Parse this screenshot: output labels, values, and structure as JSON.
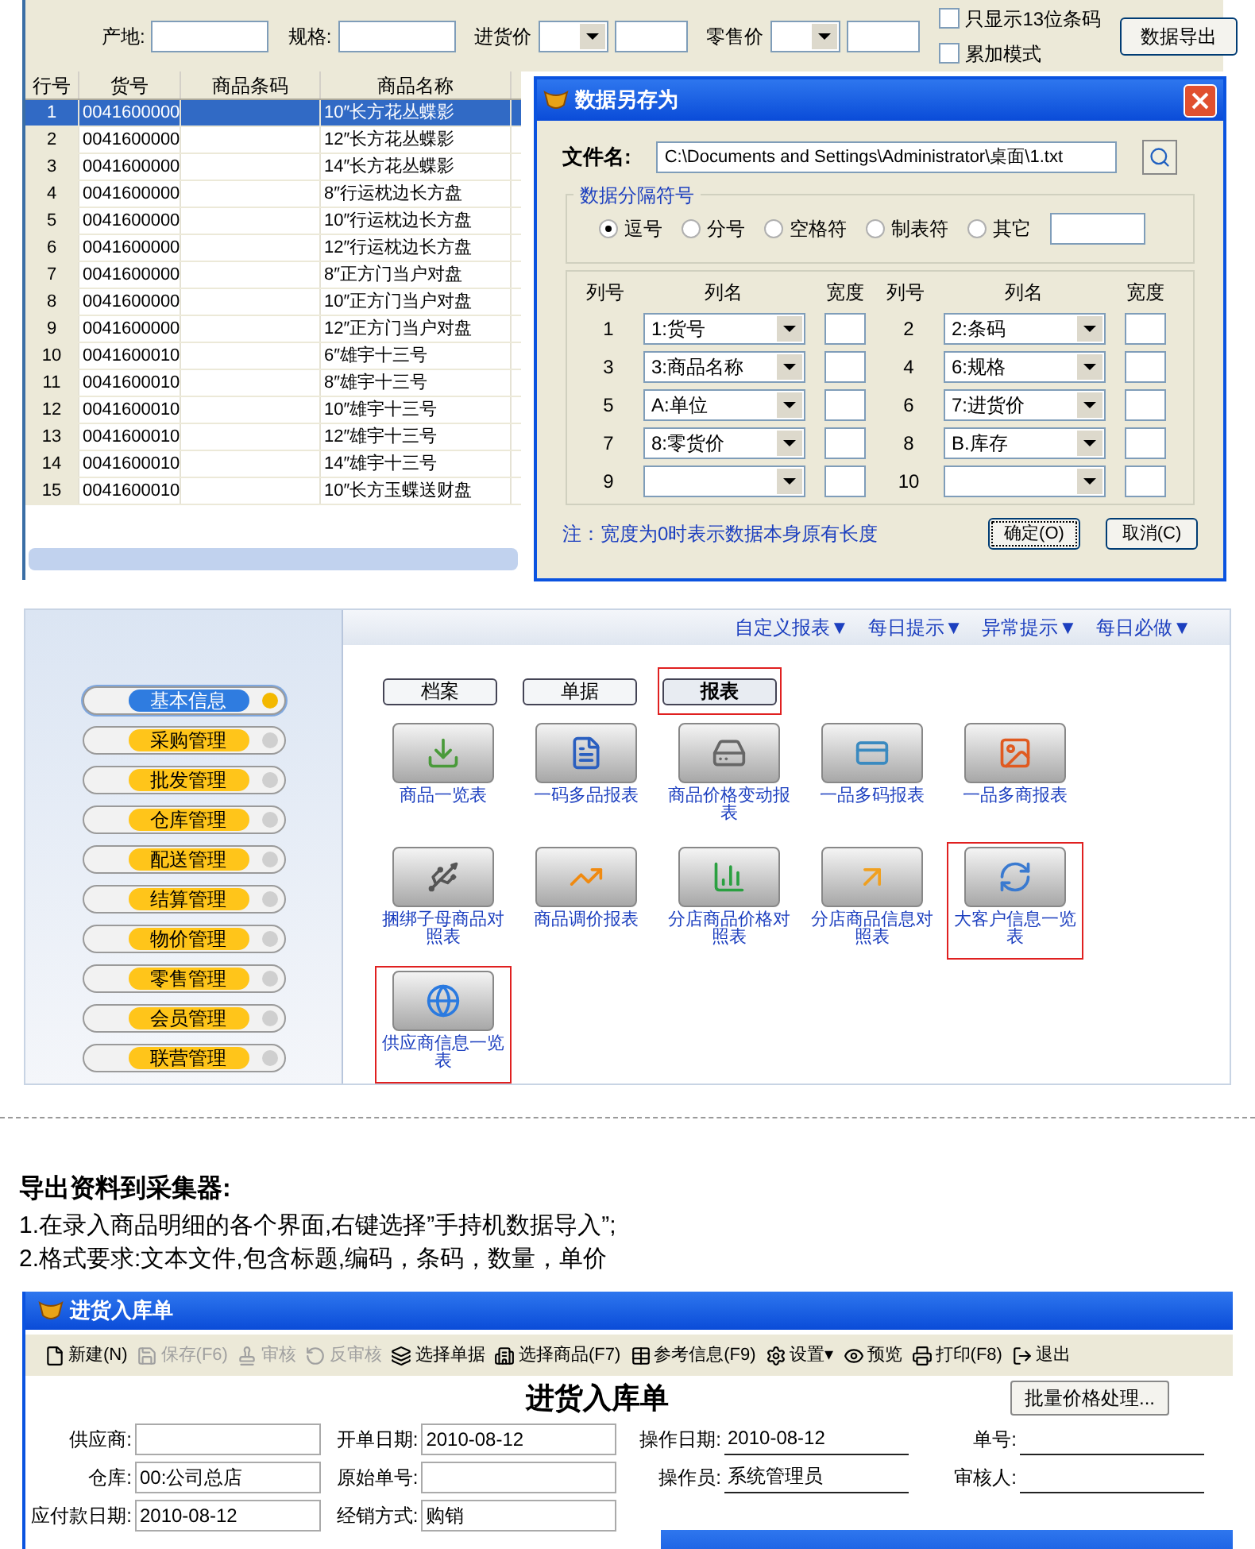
{
  "filter_bar": {
    "fields": [
      {
        "label": "产地:",
        "kind": "text"
      },
      {
        "label": "规格:",
        "kind": "text"
      },
      {
        "label": "进货价",
        "kind": "range"
      },
      {
        "label": "零售价",
        "kind": "range"
      }
    ],
    "checkboxes": [
      {
        "label": "只显示13位条码",
        "checked": false
      },
      {
        "label": "累加模式",
        "checked": false
      }
    ],
    "export_button": "数据导出"
  },
  "grid": {
    "columns": [
      "行号",
      "货号",
      "商品条码",
      "商品名称"
    ],
    "rows": [
      {
        "cells": [
          "1",
          "0041600000",
          "",
          "10″长方花丛蝶影"
        ],
        "selected": true
      },
      {
        "cells": [
          "2",
          "0041600000",
          "",
          "12″长方花丛蝶影"
        ],
        "selected": false
      },
      {
        "cells": [
          "3",
          "0041600000",
          "",
          "14″长方花丛蝶影"
        ],
        "selected": false
      },
      {
        "cells": [
          "4",
          "0041600000",
          "",
          "8″行运枕边长方盘"
        ],
        "selected": false
      },
      {
        "cells": [
          "5",
          "0041600000",
          "",
          "10″行运枕边长方盘"
        ],
        "selected": false
      },
      {
        "cells": [
          "6",
          "0041600000",
          "",
          "12″行运枕边长方盘"
        ],
        "selected": false
      },
      {
        "cells": [
          "7",
          "0041600000",
          "",
          "8″正方门当户对盘"
        ],
        "selected": false
      },
      {
        "cells": [
          "8",
          "0041600000",
          "",
          "10″正方门当户对盘"
        ],
        "selected": false
      },
      {
        "cells": [
          "9",
          "0041600000",
          "",
          "12″正方门当户对盘"
        ],
        "selected": false
      },
      {
        "cells": [
          "10",
          "0041600010",
          "",
          "6″雄宇十三号"
        ],
        "selected": false
      },
      {
        "cells": [
          "11",
          "0041600010",
          "",
          "8″雄宇十三号"
        ],
        "selected": false
      },
      {
        "cells": [
          "12",
          "0041600010",
          "",
          "10″雄宇十三号"
        ],
        "selected": false
      },
      {
        "cells": [
          "13",
          "0041600010",
          "",
          "12″雄宇十三号"
        ],
        "selected": false
      },
      {
        "cells": [
          "14",
          "0041600010",
          "",
          "14″雄宇十三号"
        ],
        "selected": false
      },
      {
        "cells": [
          "15",
          "0041600010",
          "",
          "10″长方玉蝶送财盘"
        ],
        "selected": false
      }
    ]
  },
  "save_dialog": {
    "title": "数据另存为",
    "file_label": "文件名:",
    "file_value": "C:\\Documents and Settings\\Administrator\\桌面\\1.txt",
    "separator_title": "数据分隔符号",
    "separators": [
      {
        "label": "逗号",
        "selected": true
      },
      {
        "label": "分号",
        "selected": false
      },
      {
        "label": "空格符",
        "selected": false
      },
      {
        "label": "制表符",
        "selected": false
      },
      {
        "label": "其它",
        "selected": false
      }
    ],
    "column_headers": [
      [
        "列号",
        "列名",
        "宽度"
      ],
      [
        "列号",
        "列名",
        "宽度"
      ]
    ],
    "columns": [
      {
        "no": "1",
        "name": "1:货号"
      },
      {
        "no": "2",
        "name": "2:条码"
      },
      {
        "no": "3",
        "name": "3:商品名称"
      },
      {
        "no": "4",
        "name": "6:规格"
      },
      {
        "no": "5",
        "name": "A:单位"
      },
      {
        "no": "6",
        "name": "7:进货价"
      },
      {
        "no": "7",
        "name": "8:零货价"
      },
      {
        "no": "8",
        "name": "B.库存"
      },
      {
        "no": "9"
      },
      {
        "no": "10"
      }
    ],
    "note": "注：宽度为0时表示数据本身原有长度",
    "buttons": [
      "确定(O)",
      "取消(C)"
    ]
  },
  "main_app": {
    "top_links": [
      "自定义报表▼",
      "每日提示▼",
      "异常提示▼",
      "每日必做▼"
    ],
    "sidebar": [
      {
        "label": "基本信息",
        "selected": true
      },
      {
        "label": "采购管理",
        "selected": false
      },
      {
        "label": "批发管理",
        "selected": false
      },
      {
        "label": "仓库管理",
        "selected": false
      },
      {
        "label": "配送管理",
        "selected": false
      },
      {
        "label": "结算管理",
        "selected": false
      },
      {
        "label": "物价管理",
        "selected": false
      },
      {
        "label": "零售管理",
        "selected": false
      },
      {
        "label": "会员管理",
        "selected": false
      },
      {
        "label": "联营管理",
        "selected": false
      }
    ],
    "tabs": [
      {
        "label": "档案",
        "selected": false
      },
      {
        "label": "单据",
        "selected": false
      },
      {
        "label": "报表",
        "selected": true
      }
    ],
    "reports": [
      {
        "label": "商品一览表",
        "highlighted": false
      },
      {
        "label": "一码多品报表",
        "highlighted": false
      },
      {
        "label": "商品价格变动报表",
        "highlighted": false
      },
      {
        "label": "一品多码报表",
        "highlighted": false
      },
      {
        "label": "一品多商报表",
        "highlighted": false
      },
      {
        "label": "捆绑子母商品对照表",
        "highlighted": false
      },
      {
        "label": "商品调价报表",
        "highlighted": false
      },
      {
        "label": "分店商品价格对照表",
        "highlighted": false
      },
      {
        "label": "分店商品信息对照表",
        "highlighted": false
      },
      {
        "label": "大客户信息一览表",
        "highlighted": true
      },
      {
        "label": "供应商信息一览表",
        "highlighted": true
      }
    ]
  },
  "article": {
    "heading": "导出资料到采集器:",
    "lines": [
      "1.在录入商品明细的各个界面,右键选择”手持机数据导入”;",
      "2.格式要求:文本文件,包含标题,编码，条码，数量，单价"
    ]
  },
  "receipt_window": {
    "title": "进货入库单",
    "toolbar": [
      {
        "label": "新建(N)",
        "disabled": false
      },
      {
        "label": "保存(F6)",
        "disabled": true
      },
      {
        "label": "审核",
        "disabled": true
      },
      {
        "label": "反审核",
        "disabled": true
      },
      {
        "label": "选择单据",
        "disabled": false
      },
      {
        "label": "选择商品(F7)",
        "disabled": false
      },
      {
        "label": "参考信息(F9)",
        "disabled": false
      },
      {
        "label": "设置▾",
        "disabled": false
      },
      {
        "label": "预览",
        "disabled": false
      },
      {
        "label": "打印(F8)",
        "disabled": false
      },
      {
        "label": "退出",
        "disabled": false
      }
    ],
    "form_title": "进货入库单",
    "batch_button": "批量价格处理...",
    "rows": [
      [
        {
          "label": "供应商:"
        },
        {
          "label": "开单日期:",
          "value": "2010-08-12"
        },
        {
          "label": "操作日期:",
          "value": "2010-08-12"
        },
        {
          "label": "单号:"
        }
      ],
      [
        {
          "label": "仓库:",
          "value": "00:公司总店"
        },
        {
          "label": "原始单号:"
        },
        {
          "label": "操作员:",
          "value": "系统管理员"
        },
        {
          "label": "审核人:"
        }
      ],
      [
        {
          "label": "应付款日期:",
          "value": "2010-08-12"
        },
        {
          "label": "经销方式:",
          "value": "购销"
        }
      ]
    ]
  }
}
